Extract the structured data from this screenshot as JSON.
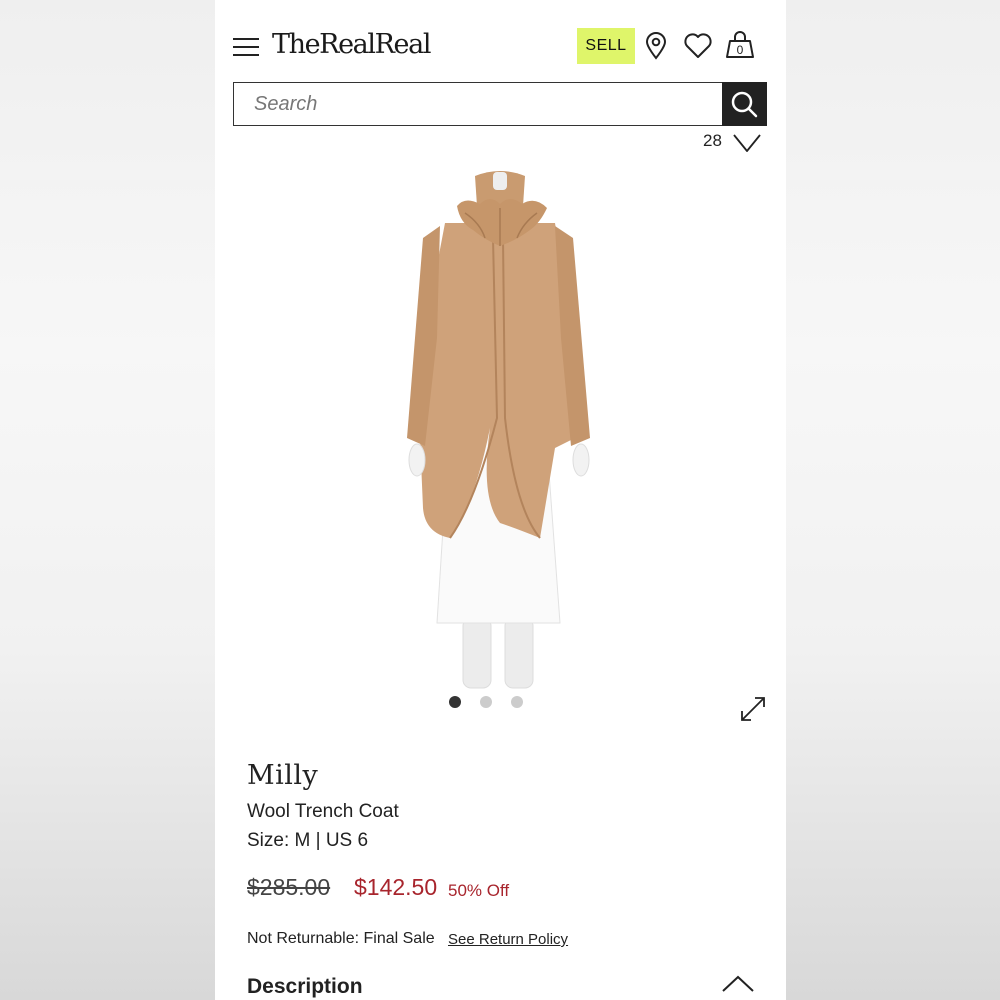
{
  "header": {
    "logo": "TheRealReal",
    "sell_label": "SELL",
    "cart_count": "0",
    "icons": [
      "menu-icon",
      "location-pin-icon",
      "heart-icon",
      "shopping-bag-icon"
    ],
    "accent_color": "#dff56a"
  },
  "search": {
    "placeholder": "Search",
    "value": "",
    "icon": "search-icon"
  },
  "favorites": {
    "count": "28"
  },
  "gallery": {
    "image_count": 3,
    "active_index": 0,
    "image_alt": "Milly Wool Trench Coat on mannequin"
  },
  "product": {
    "brand": "Milly",
    "name": "Wool Trench Coat",
    "size": "Size: M | US 6",
    "original_price": "$285.00",
    "sale_price": "$142.50",
    "discount": "50% Off",
    "return_policy": "Not Returnable: Final Sale",
    "return_link": "See Return Policy",
    "sale_color": "#a8252d"
  },
  "sections": {
    "description_title": "Description"
  }
}
